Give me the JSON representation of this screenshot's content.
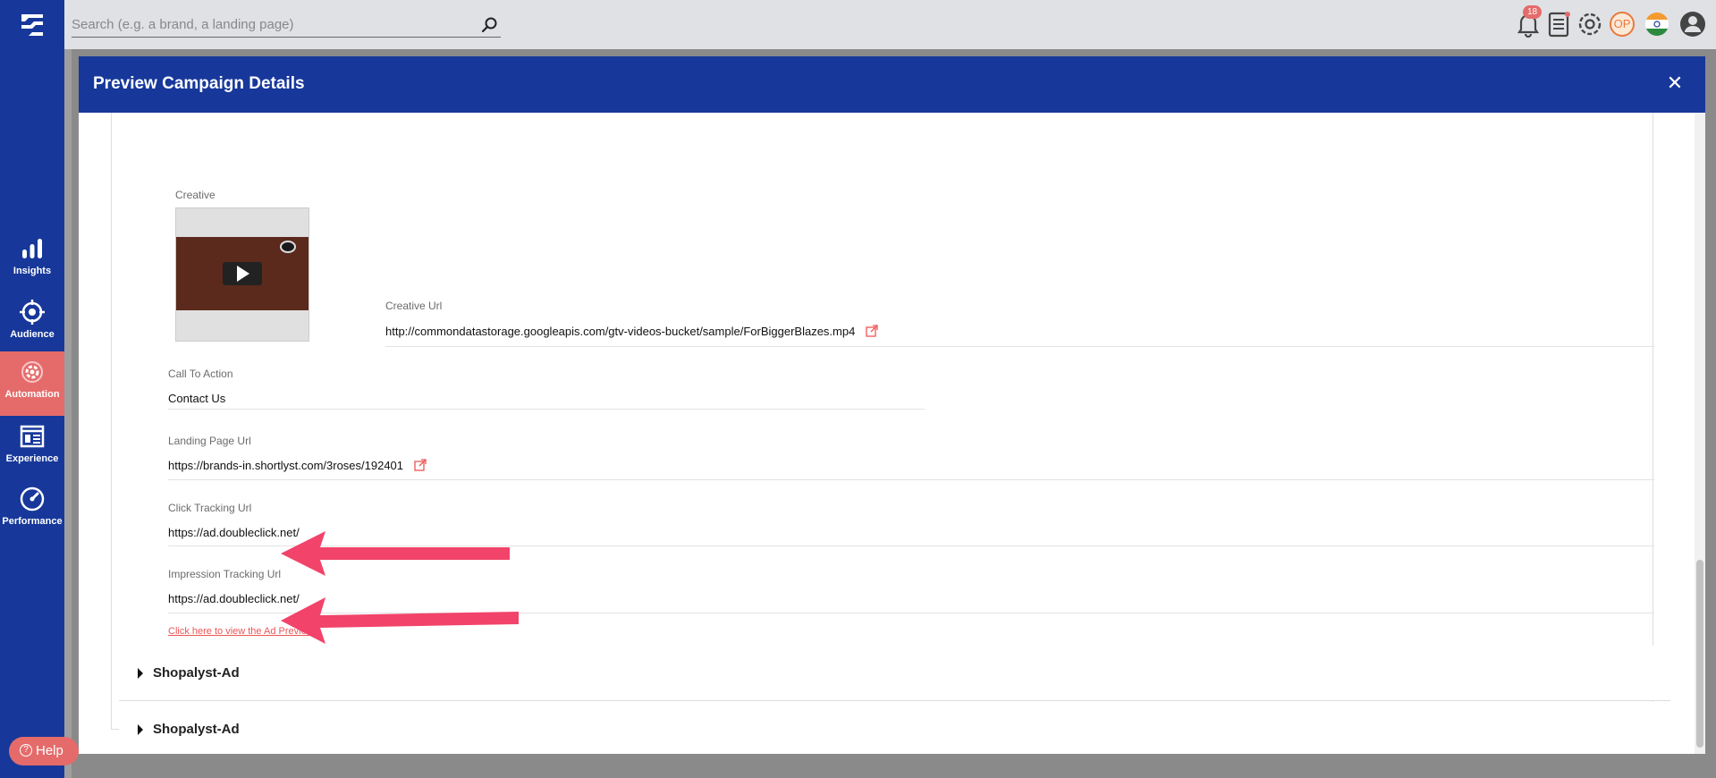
{
  "sidebar": {
    "items": [
      {
        "label": "Insights",
        "icon": "bar-chart-icon"
      },
      {
        "label": "Audience",
        "icon": "target-icon"
      },
      {
        "label": "Automation",
        "icon": "gear-icon"
      },
      {
        "label": "Experience",
        "icon": "layout-icon"
      },
      {
        "label": "Performance",
        "icon": "speedometer-icon"
      }
    ],
    "active": "Automation",
    "help_label": "Help"
  },
  "topbar": {
    "search_placeholder": "Search (e.g. a brand, a landing page)",
    "notification_count": "18",
    "avatar_initials": "OP"
  },
  "modal": {
    "title": "Preview Campaign Details",
    "fields": {
      "creative_label": "Creative",
      "creative_url_label": "Creative Url",
      "creative_url_value": "http://commondatastorage.googleapis.com/gtv-videos-bucket/sample/ForBiggerBlazes.mp4",
      "cta_label": "Call To Action",
      "cta_value": "Contact Us",
      "landing_label": "Landing Page Url",
      "landing_value": "https://brands-in.shortlyst.com/3roses/192401",
      "click_label": "Click Tracking Url",
      "click_value": "https://ad.doubleclick.net/",
      "impression_label": "Impression Tracking Url",
      "impression_value": "https://ad.doubleclick.net/"
    },
    "ad_preview_link": "Click here to view the Ad Preview",
    "accordions": [
      "Shopalyst-Ad",
      "Shopalyst-Ad"
    ]
  },
  "colors": {
    "brand_blue": "#17389a",
    "accent_red": "#e56b6b",
    "annotation_arrow": "#f2436a"
  }
}
